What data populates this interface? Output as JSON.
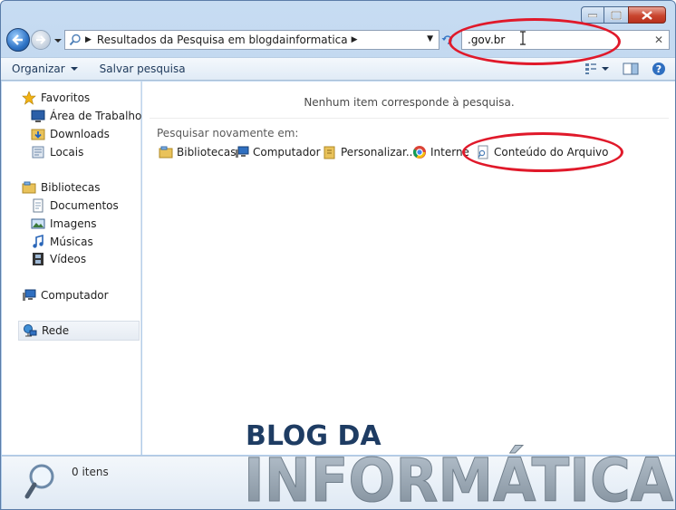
{
  "address_bar": {
    "breadcrumb": "Resultados da Pesquisa em blogdainformatica",
    "search_value": ".gov.br"
  },
  "toolbar": {
    "organize_label": "Organizar",
    "save_search_label": "Salvar pesquisa"
  },
  "nav_pane": {
    "favorites_label": "Favoritos",
    "favorites": [
      "Área de Trabalho",
      "Downloads",
      "Locais"
    ],
    "libraries_label": "Bibliotecas",
    "libraries": [
      "Documentos",
      "Imagens",
      "Músicas",
      "Vídeos"
    ],
    "computer_label": "Computador",
    "network_label": "Rede"
  },
  "content": {
    "no_results": "Nenhum item corresponde à pesquisa.",
    "search_again_label": "Pesquisar novamente em:",
    "locations": [
      "Bibliotecas",
      "Computador",
      "Personalizar...",
      "Interne",
      "Conteúdo do Arquivo"
    ]
  },
  "details": {
    "item_count": "0 itens"
  },
  "watermark": {
    "line1": "BLOG DA",
    "line2": "INFORMÁTICA"
  },
  "colors": {
    "annotation": "#e0192a",
    "accent": "#1e395b"
  }
}
